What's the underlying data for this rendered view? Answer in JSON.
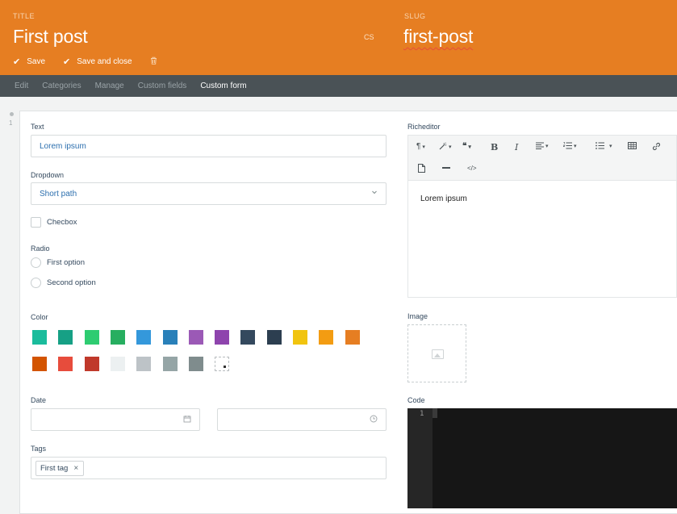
{
  "header": {
    "title_label": "TITLE",
    "title_value": "First post",
    "language_code": "CS",
    "slug_label": "SLUG",
    "slug_value": "first-post",
    "save_label": "Save",
    "save_close_label": "Save and close",
    "accent_color": "#e67e22"
  },
  "tabs": [
    {
      "label": "Edit",
      "active": false
    },
    {
      "label": "Categories",
      "active": false
    },
    {
      "label": "Manage",
      "active": false
    },
    {
      "label": "Custom fields",
      "active": false
    },
    {
      "label": "Custom form",
      "active": true
    }
  ],
  "row_number": "1",
  "form": {
    "text": {
      "label": "Text",
      "value": "Lorem ipsum"
    },
    "dropdown": {
      "label": "Dropdown",
      "value": "Short path"
    },
    "checkbox": {
      "label": "Checbox",
      "checked": false
    },
    "radio": {
      "label": "Radio",
      "options": [
        "First option",
        "Second option"
      ]
    },
    "color": {
      "label": "Color",
      "swatches": [
        "#1abc9c",
        "#16a085",
        "#2ecc71",
        "#27ae60",
        "#3498db",
        "#2980b9",
        "#9b59b6",
        "#8e44ad",
        "#34495e",
        "#2c3e50",
        "#f1c40f",
        "#f39c12",
        "#e67e22",
        "#d35400",
        "#e74c3c",
        "#c0392b",
        "#ecf0f1",
        "#bdc3c7",
        "#95a5a6",
        "#7f8c8d",
        "transparent"
      ]
    },
    "date": {
      "label": "Date",
      "date_value": "",
      "time_value": ""
    },
    "tags": {
      "label": "Tags",
      "items": [
        "First tag"
      ]
    }
  },
  "richeditor": {
    "label": "Richeditor",
    "content": "Lorem ipsum",
    "toolbar_icons": [
      "paragraph-icon",
      "magic-wand-icon",
      "quote-icon",
      "bold-icon",
      "italic-icon",
      "align-icon",
      "ordered-list-icon",
      "unordered-list-icon",
      "table-icon",
      "link-icon",
      "file-icon",
      "horizontal-rule-icon",
      "code-view-icon"
    ]
  },
  "image": {
    "label": "Image"
  },
  "code": {
    "label": "Code",
    "line_numbers": [
      "1"
    ]
  }
}
